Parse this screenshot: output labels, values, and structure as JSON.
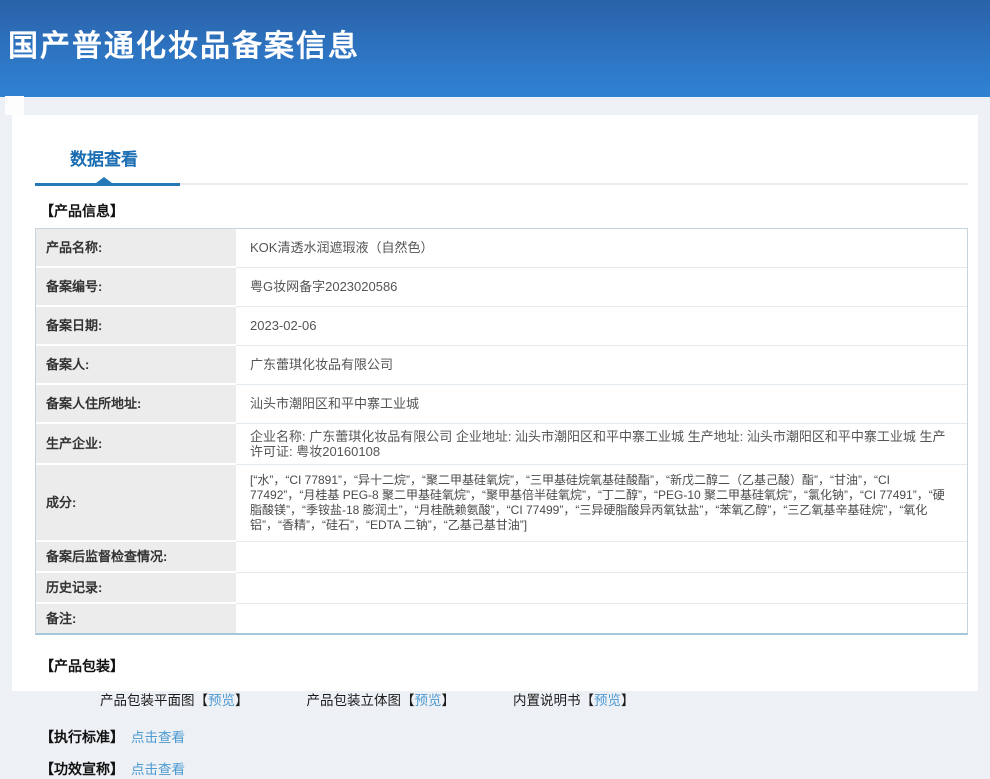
{
  "header": {
    "title": "国产普通化妆品备案信息"
  },
  "tabs": {
    "data_view": "数据查看"
  },
  "sections": {
    "product_info": "【产品信息】",
    "product_packaging": "【产品包装】",
    "standard": "【执行标准】",
    "efficacy": "【功效宣称】"
  },
  "product_table": {
    "rows": [
      {
        "label": "产品名称:",
        "value": "KOK清透水润遮瑕液（自然色）"
      },
      {
        "label": "备案编号:",
        "value": "粤G妆网备字2023020586"
      },
      {
        "label": "备案日期:",
        "value": "2023-02-06"
      },
      {
        "label": "备案人:",
        "value": "广东蕾琪化妆品有限公司"
      },
      {
        "label": "备案人住所地址:",
        "value": "汕头市潮阳区和平中寨工业城"
      },
      {
        "label": "生产企业:",
        "value": "企业名称: 广东蕾琪化妆品有限公司 企业地址: 汕头市潮阳区和平中寨工业城 生产地址: 汕头市潮阳区和平中寨工业城 生产许可证: 粤妆20160108"
      },
      {
        "label": "成分:",
        "value": "[“水”，“CI 77891”，“异十二烷”，“聚二甲基硅氧烷”，“三甲基硅烷氧基硅酸酯”，“新戊二醇二（乙基己酸）酯”，“甘油”，“CI 77492”，“月桂基 PEG-8 聚二甲基硅氧烷”，“聚甲基倍半硅氧烷”，“丁二醇”，“PEG-10 聚二甲基硅氧烷”，“氯化钠”，“CI 77491”，“硬脂酸镁”，“季铵盐-18 膨润土”，“月桂酰赖氨酸”，“CI 77499”，“三异硬脂酸异丙氧钛盐”，“苯氧乙醇”，“三乙氧基辛基硅烷”，“氧化铝”，“香精”，“硅石”，“EDTA 二钠”，“乙基己基甘油”]"
      },
      {
        "label": "备案后监督检查情况:",
        "value": ""
      },
      {
        "label": "历史记录:",
        "value": ""
      },
      {
        "label": "备注:",
        "value": ""
      }
    ]
  },
  "packaging": {
    "bracket_open": "【",
    "bracket_close": "】",
    "preview_label": "预览",
    "items": [
      {
        "label": "产品包装平面图"
      },
      {
        "label": "产品包装立体图"
      },
      {
        "label": "内置说明书"
      }
    ]
  },
  "links": {
    "click_view": "点击查看"
  },
  "colors": {
    "banner_gradient_top": "#2a62a8",
    "banner_gradient_bottom": "#2f83d3",
    "tab_accent": "#2478b6",
    "tab_text": "#1a6db3",
    "link_blue": "#4e9ad2",
    "label_cell_bg": "#ececec",
    "page_bg": "#edf1f5"
  }
}
